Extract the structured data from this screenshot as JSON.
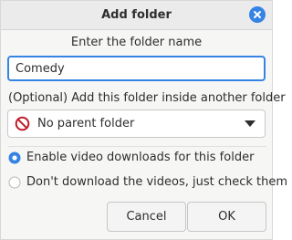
{
  "dialog": {
    "title": "Add folder",
    "close_icon": "close-icon"
  },
  "folder_name": {
    "heading": "Enter the folder name",
    "value": "Comedy"
  },
  "parent": {
    "label": "(Optional) Add this folder inside another folder",
    "selected": "No parent folder",
    "icon": "no-entry-icon"
  },
  "options": [
    {
      "label": "Enable video downloads for this folder",
      "selected": true
    },
    {
      "label": "Don't download the videos, just check them",
      "selected": false
    }
  ],
  "buttons": {
    "cancel": "Cancel",
    "ok": "OK"
  },
  "colors": {
    "accent": "#3584e4",
    "no_entry": "#c01c28"
  }
}
